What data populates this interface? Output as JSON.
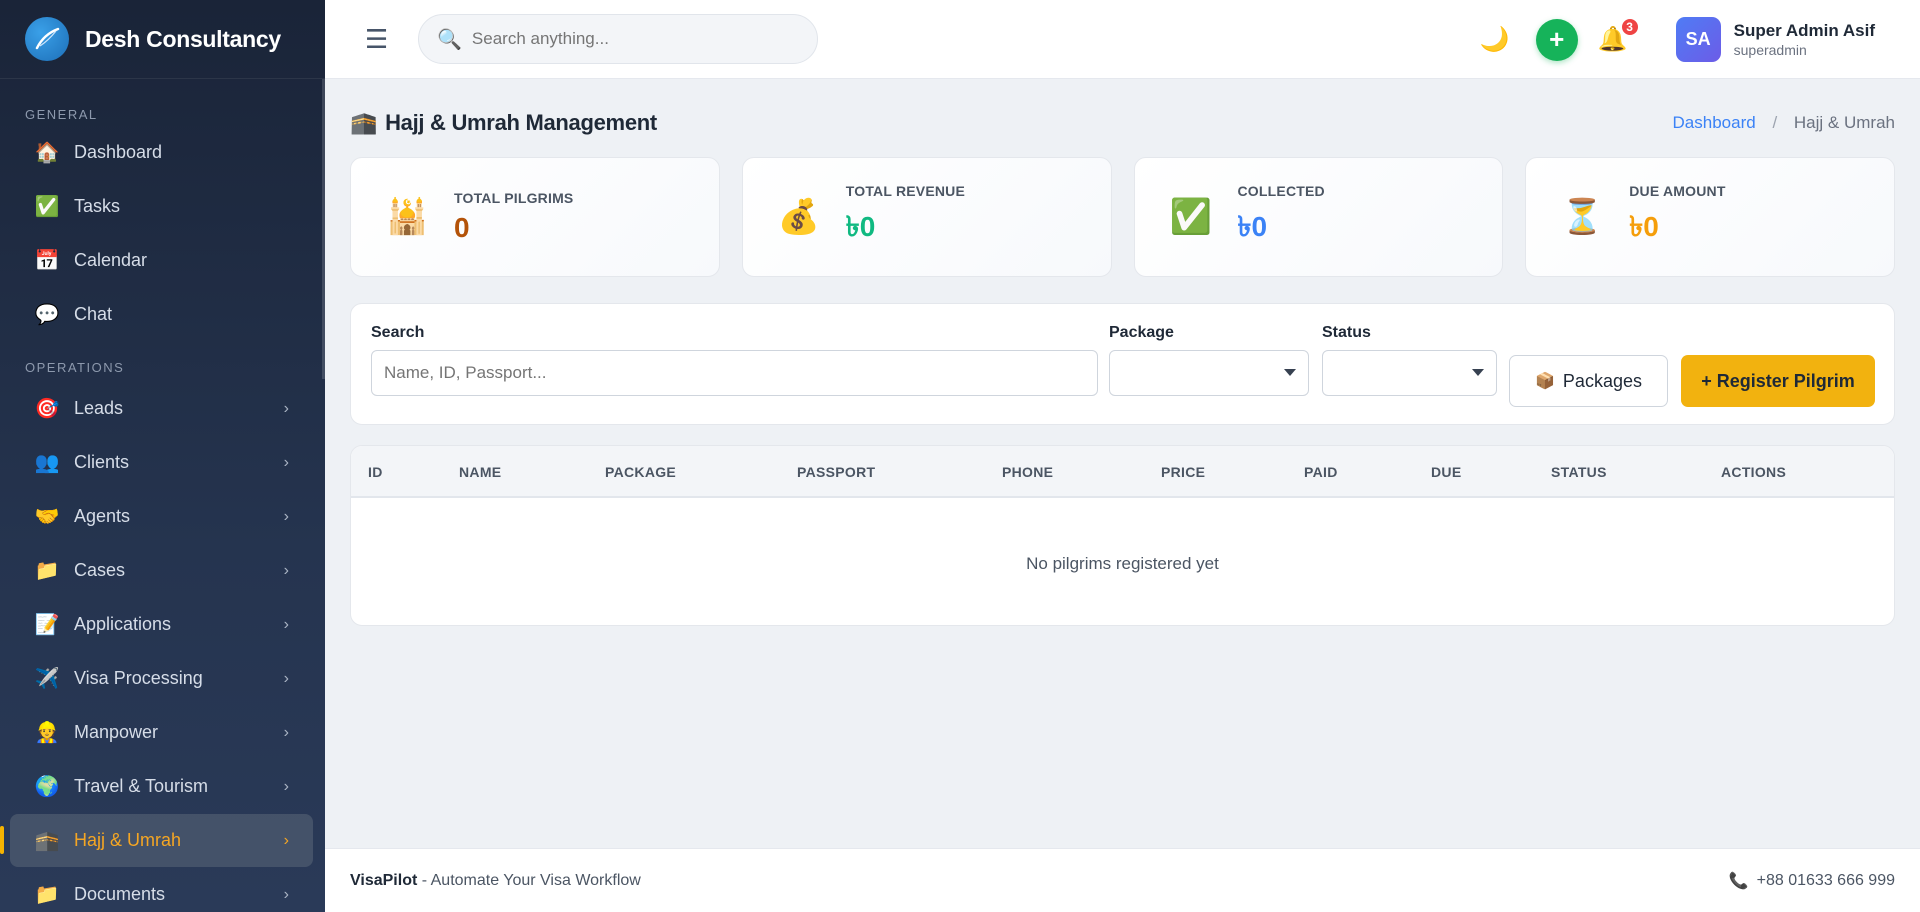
{
  "brand": {
    "name": "Desh Consultancy"
  },
  "sidebar": {
    "section_general": "GENERAL",
    "section_operations": "OPERATIONS",
    "general_items": [
      {
        "label": "Dashboard",
        "icon": "🏠",
        "icon_name": "house-icon"
      },
      {
        "label": "Tasks",
        "icon": "✅",
        "icon_name": "checkbox-icon"
      },
      {
        "label": "Calendar",
        "icon": "📅",
        "icon_name": "calendar-icon"
      },
      {
        "label": "Chat",
        "icon": "💬",
        "icon_name": "speech-bubble-icon"
      }
    ],
    "operation_items": [
      {
        "label": "Leads",
        "icon": "🎯",
        "icon_name": "target-icon"
      },
      {
        "label": "Clients",
        "icon": "👥",
        "icon_name": "people-icon"
      },
      {
        "label": "Agents",
        "icon": "🤝",
        "icon_name": "handshake-icon"
      },
      {
        "label": "Cases",
        "icon": "📁",
        "icon_name": "folder-icon"
      },
      {
        "label": "Applications",
        "icon": "📝",
        "icon_name": "memo-icon"
      },
      {
        "label": "Visa Processing",
        "icon": "✈️",
        "icon_name": "airplane-icon"
      },
      {
        "label": "Manpower",
        "icon": "👷",
        "icon_name": "worker-icon"
      },
      {
        "label": "Travel & Tourism",
        "icon": "🌍",
        "icon_name": "globe-icon"
      },
      {
        "label": "Hajj & Umrah",
        "icon": "🕋",
        "icon_name": "kaaba-icon",
        "active": true
      },
      {
        "label": "Documents",
        "icon": "📁",
        "icon_name": "folder-icon"
      }
    ],
    "chevron": "›"
  },
  "header": {
    "menu_icon": "☰",
    "search_placeholder": "Search anything...",
    "notification_count": "3",
    "user_initials": "SA",
    "user_name": "Super Admin Asif",
    "user_role": "superadmin"
  },
  "page": {
    "title": "Hajj & Umrah Management",
    "breadcrumb_home": "Dashboard",
    "breadcrumb_sep": "/",
    "breadcrumb_current": "Hajj & Umrah"
  },
  "stats": [
    {
      "label": "TOTAL PILGRIMS",
      "value": "0",
      "icon": "🕌",
      "color": "#b45309"
    },
    {
      "label": "TOTAL REVENUE",
      "value": "৳0",
      "icon": "💰",
      "color": "#10b981"
    },
    {
      "label": "COLLECTED",
      "value": "৳0",
      "icon": "✅",
      "color": "#3b82f6"
    },
    {
      "label": "DUE AMOUNT",
      "value": "৳0",
      "icon": "⏳",
      "color": "#f59e0b"
    }
  ],
  "filters": {
    "search_label": "Search",
    "search_placeholder": "Name, ID, Passport...",
    "package_label": "Package",
    "package_value": "",
    "status_label": "Status",
    "status_value": "",
    "packages_button": "Packages",
    "register_button": "+ Register Pilgrim"
  },
  "table": {
    "columns": [
      "ID",
      "NAME",
      "PACKAGE",
      "PASSPORT",
      "PHONE",
      "PRICE",
      "PAID",
      "DUE",
      "STATUS",
      "ACTIONS"
    ],
    "empty_message": "No pilgrims registered yet"
  },
  "footer": {
    "brand": "VisaPilot",
    "tagline": " - Automate Your Visa Workflow",
    "phone": "+88 01633 666 999"
  },
  "colors": {
    "accent": "#f2b20f",
    "sidebar_bg": "#1a2438",
    "add_button": "#16b35a"
  }
}
